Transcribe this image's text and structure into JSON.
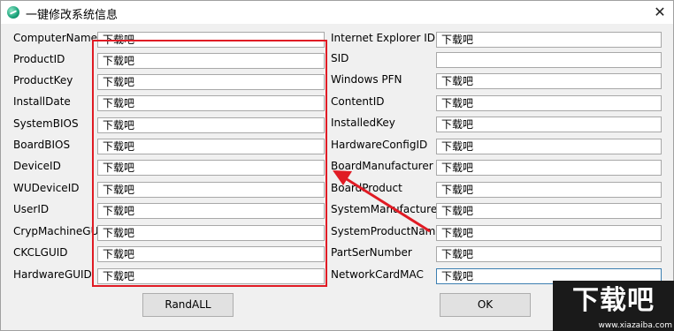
{
  "window": {
    "title": "一键修改系统信息",
    "close_glyph": "✕"
  },
  "left_fields": [
    {
      "label": "ComputerName",
      "value": "下载吧"
    },
    {
      "label": "ProductID",
      "value": "下载吧"
    },
    {
      "label": "ProductKey",
      "value": "下载吧"
    },
    {
      "label": "InstallDate",
      "value": "下载吧"
    },
    {
      "label": "SystemBIOS",
      "value": "下载吧"
    },
    {
      "label": "BoardBIOS",
      "value": "下载吧"
    },
    {
      "label": "DeviceID",
      "value": "下载吧"
    },
    {
      "label": "WUDeviceID",
      "value": "下载吧"
    },
    {
      "label": "UserID",
      "value": "下载吧"
    },
    {
      "label": "CrypMachineGUID",
      "value": "下载吧"
    },
    {
      "label": "CKCLGUID",
      "value": "下载吧"
    },
    {
      "label": "HardwareGUID",
      "value": "下载吧"
    }
  ],
  "right_fields": [
    {
      "label": "Internet Explorer ID",
      "value": "下载吧"
    },
    {
      "label": "SID",
      "value": ""
    },
    {
      "label": "Windows PFN",
      "value": "下载吧"
    },
    {
      "label": "ContentID",
      "value": "下载吧"
    },
    {
      "label": "InstalledKey",
      "value": "下载吧"
    },
    {
      "label": "HardwareConfigID",
      "value": "下载吧"
    },
    {
      "label": "BoardManufacturer",
      "value": "下载吧"
    },
    {
      "label": "BoardProduct",
      "value": "下载吧"
    },
    {
      "label": "SystemManufacturer",
      "value": "下载吧"
    },
    {
      "label": "SystemProductName",
      "value": "下载吧"
    },
    {
      "label": "PartSerNumber",
      "value": "下载吧"
    },
    {
      "label": "NetworkCardMAC",
      "value": "下载吧"
    }
  ],
  "buttons": {
    "randall": "RandALL",
    "ok": "OK"
  },
  "annotation": {
    "color": "#e01b24"
  },
  "watermark": {
    "logo": "下载吧",
    "url": "www.xiazaiba.com"
  }
}
